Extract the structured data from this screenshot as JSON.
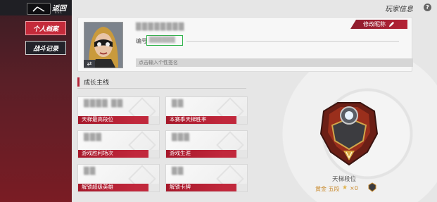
{
  "header": {
    "back_label": "返回",
    "back_sub": "ESC",
    "title": "玩家信息",
    "help": "?"
  },
  "sidebar": {
    "tabs": [
      {
        "label": "个人档案",
        "active": true
      },
      {
        "label": "战斗记录",
        "active": false
      }
    ]
  },
  "profile": {
    "name": "▒▒▒▒▒▒▒▒",
    "id_label": "编号",
    "id_value": "▒▒▒▒▒▒",
    "edit_name_label": "修改昵称",
    "signature_placeholder": "点击输入个性签名",
    "avatar_badge": "⇄"
  },
  "growth": {
    "title": "成长主线",
    "stats": [
      {
        "label": "天梯最高段位",
        "value": "▒▒▒▒ ▒▒"
      },
      {
        "label": "本赛季天梯胜率",
        "value": "▒▒"
      },
      {
        "label": "游戏胜利场次",
        "value": "▒▒▒"
      },
      {
        "label": "游戏生涯",
        "value": "▒▒▒"
      },
      {
        "label": "解锁超级英雄",
        "value": "▒▒"
      },
      {
        "label": "解锁卡牌",
        "value": "▒▒"
      }
    ]
  },
  "rank": {
    "title": "天梯段位",
    "tier": "黄金 五段",
    "stars": "×0"
  },
  "colors": {
    "accent": "#b42236",
    "highlight_box": "#2fb34a",
    "gold": "#c9892a"
  }
}
